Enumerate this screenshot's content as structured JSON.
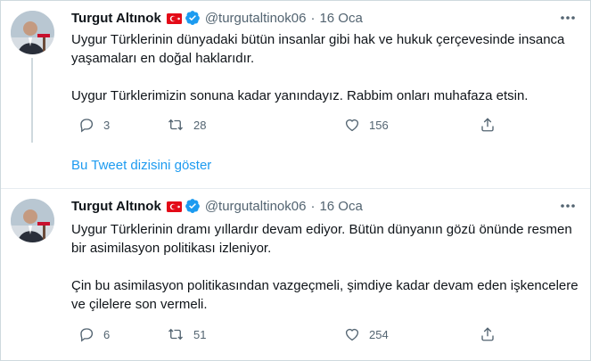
{
  "tweets": [
    {
      "author": {
        "name": "Turgut Altınok",
        "handle": "@turgutaltinok06",
        "flag_icon": "turkey-flag-icon",
        "verified_icon": "verified-badge-icon"
      },
      "separator": "·",
      "date": "16 Oca",
      "paragraphs": [
        "Uygur Türklerinin dünyadaki bütün insanlar gibi hak ve hukuk çerçevesinde insanca yaşamaları en doğal haklarıdır.",
        "Uygur Türklerimizin sonuna kadar yanındayız. Rabbim onları muhafaza etsin."
      ],
      "reply_count": "3",
      "retweet_count": "28",
      "like_count": "156",
      "show_thread": "Bu Tweet dizisini göster"
    },
    {
      "author": {
        "name": "Turgut Altınok",
        "handle": "@turgutaltinok06",
        "flag_icon": "turkey-flag-icon",
        "verified_icon": "verified-badge-icon"
      },
      "separator": "·",
      "date": "16 Oca",
      "paragraphs": [
        "Uygur Türklerinin dramı yıllardır devam ediyor. Bütün dünyanın gözü önünde resmen bir asimilasyon politikası izleniyor.",
        "Çin bu asimilasyon politikasından vazgeçmeli, şimdiye kadar devam eden işkencelere ve çilelere son vermeli."
      ],
      "reply_count": "6",
      "retweet_count": "51",
      "like_count": "254"
    }
  ],
  "colors": {
    "accent": "#1d9bf0",
    "muted": "#536471",
    "text": "#0f1419",
    "flag_red": "#e30a17"
  }
}
